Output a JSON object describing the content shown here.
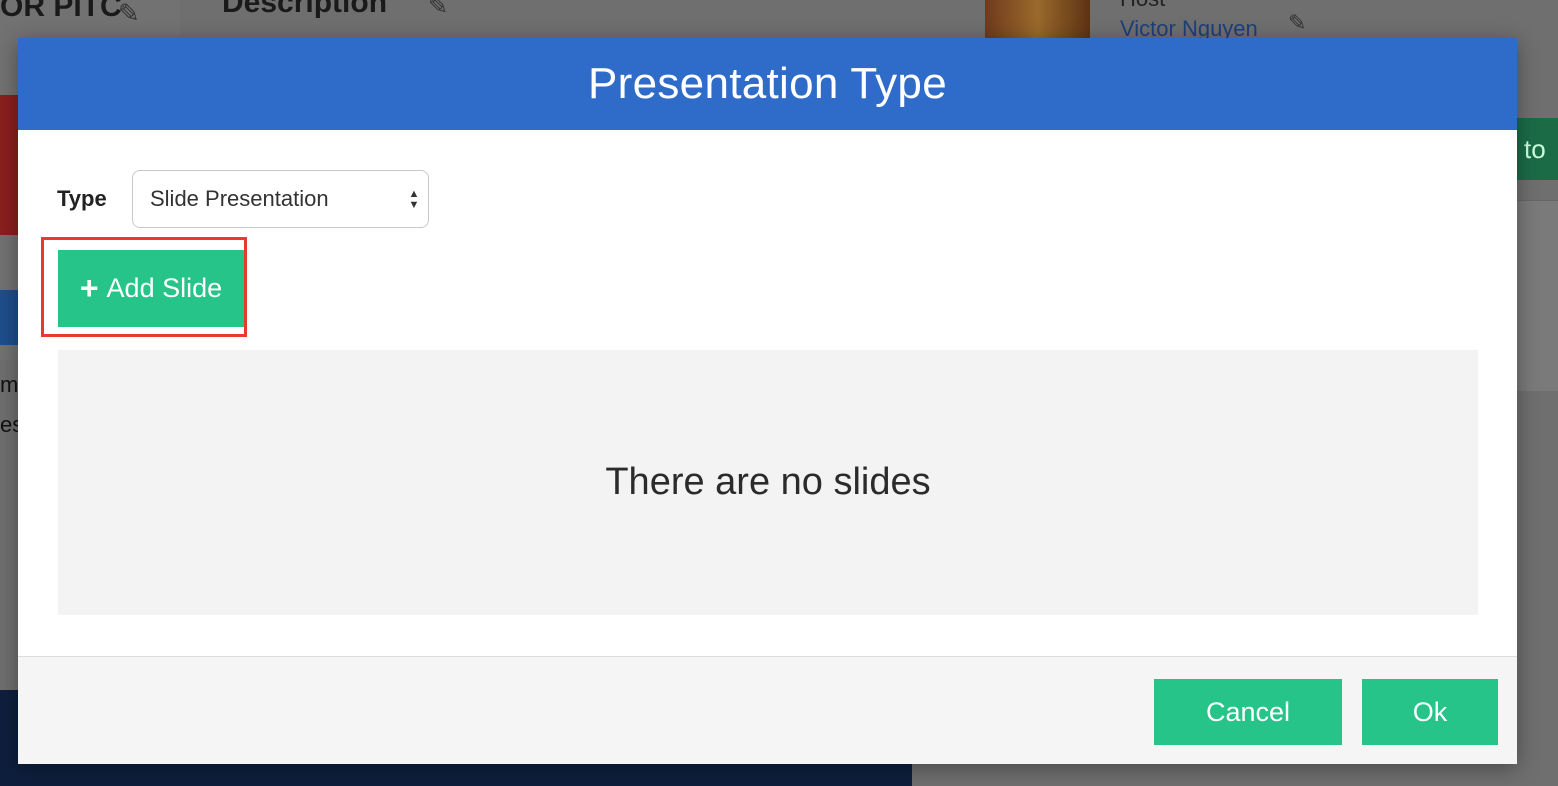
{
  "background": {
    "pitch_title": "OR PITC",
    "description_heading": "Description",
    "host_label": "Host",
    "host_name": "Victor Nguyen",
    "side_button_text": "to",
    "side_text_1": "m",
    "side_text_2": "es"
  },
  "modal": {
    "title": "Presentation Type",
    "type_label": "Type",
    "type_select": {
      "selected": "Slide Presentation"
    },
    "add_slide_label": "Add Slide",
    "empty_message": "There are no slides",
    "cancel_label": "Cancel",
    "ok_label": "Ok"
  },
  "colors": {
    "header_blue": "#2f6bc8",
    "accent_green": "#27c48a",
    "highlight_red": "#e63b2e"
  },
  "icons": {
    "add": "plus-icon",
    "select": "sort-arrows-icon",
    "edit": "pencil-icon"
  }
}
